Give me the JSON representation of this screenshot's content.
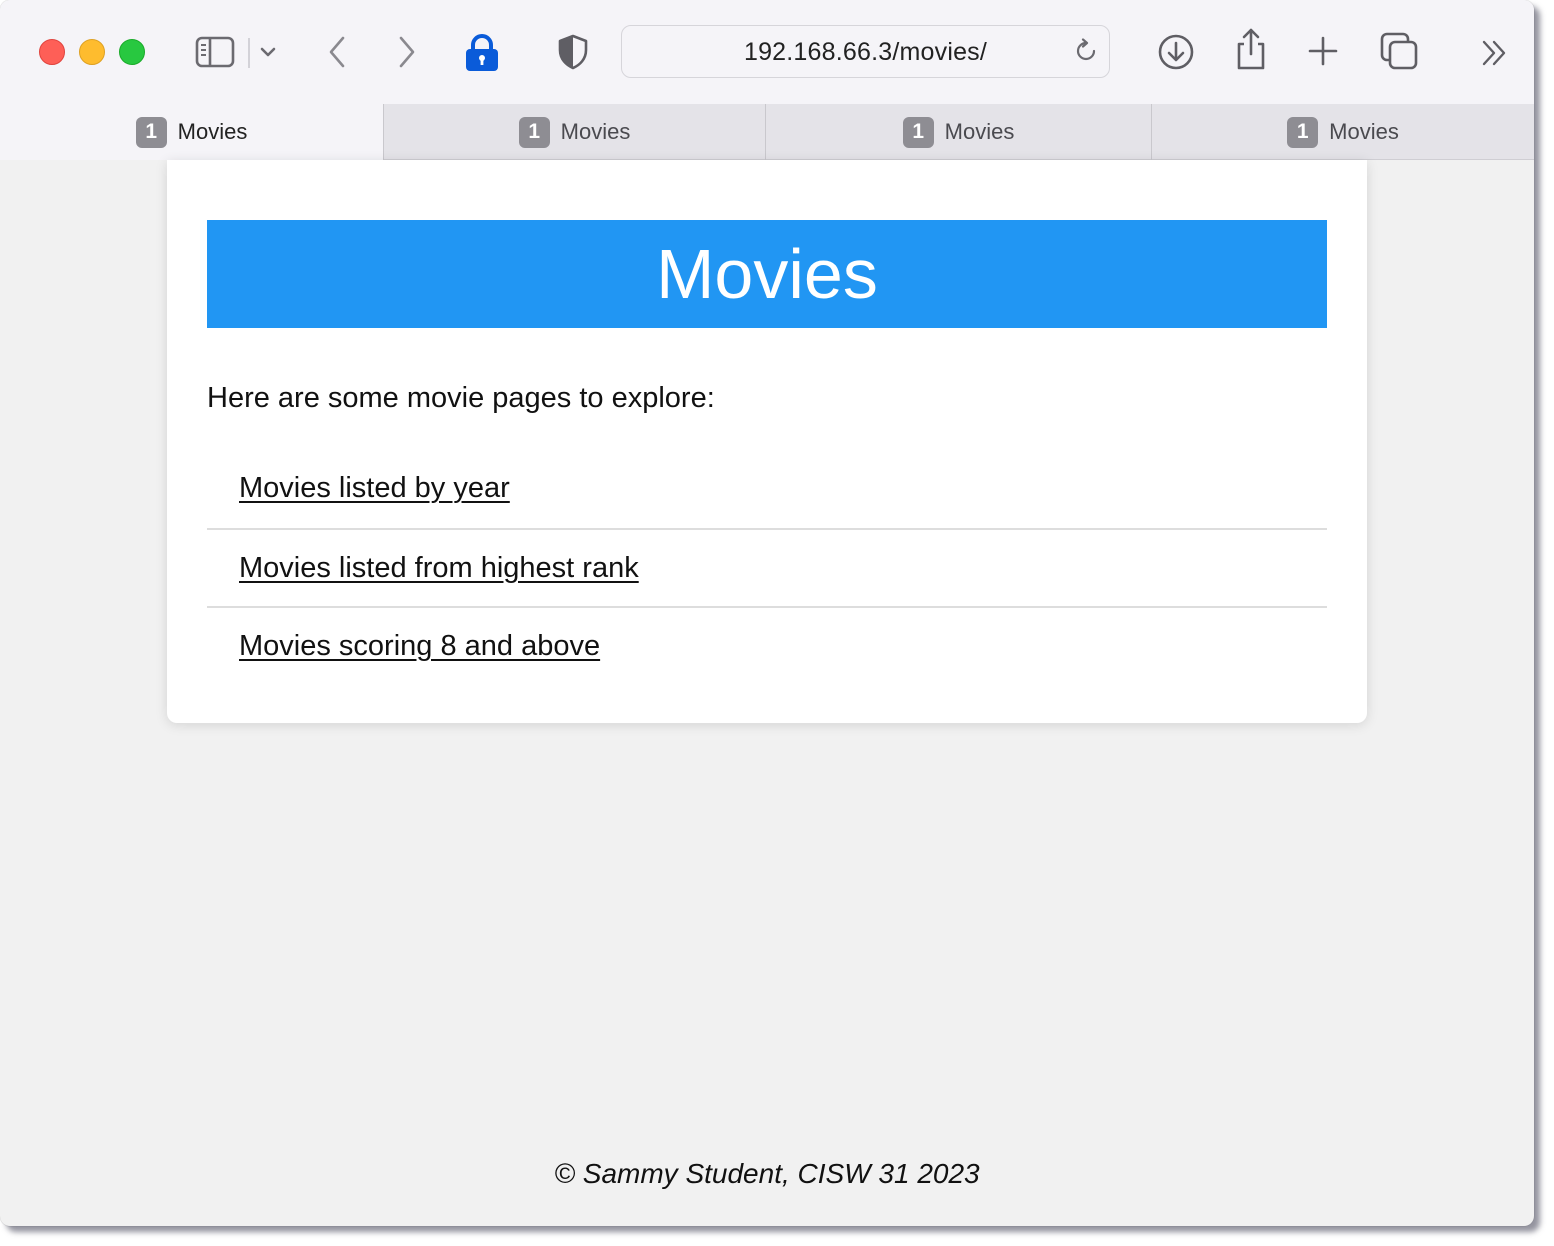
{
  "browser": {
    "address_url": "192.168.66.3/movies/",
    "tabs": [
      {
        "badge": "1",
        "label": "Movies"
      },
      {
        "badge": "1",
        "label": "Movies"
      },
      {
        "badge": "1",
        "label": "Movies"
      },
      {
        "badge": "1",
        "label": "Movies"
      }
    ],
    "icons": {
      "sidebar": "sidebar-icon",
      "sidebar_menu": "chevron-down-icon",
      "back": "chevron-left-icon",
      "forward": "chevron-right-icon",
      "privacy": "lock-icon",
      "shield": "shield-icon",
      "reload": "reload-icon",
      "downloads": "download-icon",
      "share": "share-icon",
      "new_tab": "plus-icon",
      "tab_overview": "tabs-overview-icon",
      "more": "double-chevron-right-icon"
    },
    "colors": {
      "close": "#fe5f57",
      "minimize": "#febc2e",
      "maximize": "#28c840",
      "lock": "#0a5bd9"
    }
  },
  "page": {
    "heading": "Movies",
    "heading_bg": "#2196f3",
    "intro": "Here are some movie pages to explore:",
    "links": [
      {
        "label": "Movies listed by year"
      },
      {
        "label": "Movies listed from highest rank"
      },
      {
        "label": "Movies scoring 8 and above"
      }
    ],
    "footer": "© Sammy Student, CISW 31 2023"
  }
}
